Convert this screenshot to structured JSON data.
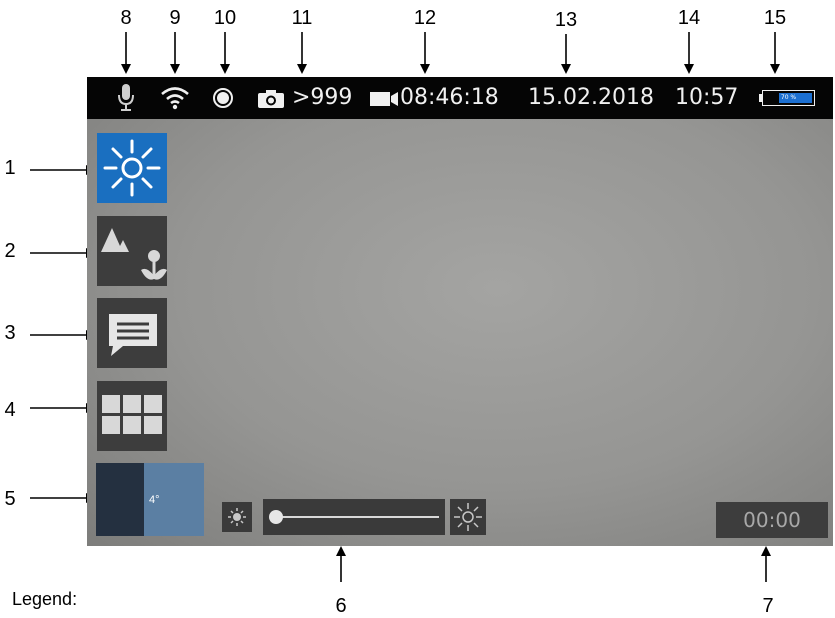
{
  "callouts": {
    "n1": "1",
    "n2": "2",
    "n3": "3",
    "n4": "4",
    "n5": "5",
    "n6": "6",
    "n7": "7",
    "n8": "8",
    "n9": "9",
    "n10": "10",
    "n11": "11",
    "n12": "12",
    "n13": "13",
    "n14": "14",
    "n15": "15"
  },
  "legend": "Legend:",
  "status_bar": {
    "photo_count": ">999",
    "video_duration": "08:46:18",
    "date": "15.02.2018",
    "time": "10:57",
    "battery_label": "70 %",
    "battery_level": 0.7,
    "battery_color": "#1c6fd0"
  },
  "sidebar": {
    "items": [
      {
        "icon": "brightness-icon",
        "active": true
      },
      {
        "icon": "image-mode-icon",
        "active": false
      },
      {
        "icon": "message-icon",
        "active": false
      },
      {
        "icon": "grid-menu-icon",
        "active": false
      }
    ],
    "active_color": "#1a6fc0"
  },
  "thumbnail": {
    "label": "4°"
  },
  "brightness_slider": {
    "value": 0.0
  },
  "timer": {
    "text": "00:00"
  }
}
